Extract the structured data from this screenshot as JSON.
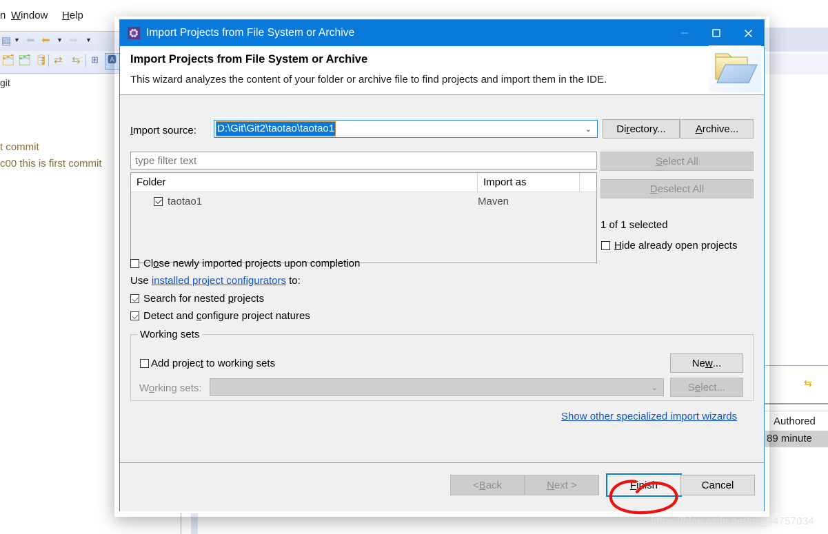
{
  "background": {
    "menu": [
      {
        "label": "n",
        "accel": ""
      },
      {
        "label": "Window",
        "accel": "W"
      },
      {
        "label": "Help",
        "accel": "H"
      }
    ],
    "label_git": "git",
    "commit_line1": "t commit",
    "commit_line2": "c00 this is first commit",
    "right_panel": {
      "authored_header": "Authored",
      "authored_value": "89 minute"
    }
  },
  "dialog": {
    "title": "Import Projects from File System or Archive",
    "window_buttons": {
      "minimize": "minimize-button",
      "maximize": "maximize-button",
      "close": "close-button"
    },
    "header": {
      "heading": "Import Projects from File System or Archive",
      "description": "This wizard analyzes the content of your folder or archive file to find projects and import them in the IDE."
    },
    "import_source": {
      "label": "Import source:",
      "label_mnemonic": "I",
      "value": "D:\\Git\\Git2\\taotao\\taotao1",
      "selected": true,
      "directory_button": "Directory...",
      "directory_mnemonic": "r",
      "archive_button": "Archive...",
      "archive_mnemonic": "A"
    },
    "filter": {
      "placeholder": "type filter text",
      "value": ""
    },
    "table": {
      "columns": [
        "Folder",
        "Import as"
      ],
      "rows": [
        {
          "folder": "taotao1",
          "import_as": "Maven",
          "checked": true
        }
      ]
    },
    "side_buttons": {
      "select_all": "Select All",
      "select_all_mnemonic": "S",
      "select_all_enabled": false,
      "deselect_all": "Deselect All",
      "deselect_all_mnemonic": "D",
      "deselect_all_enabled": false,
      "selection_status": "1 of 1 selected",
      "hide_open_projects": "Hide already open projects",
      "hide_open_projects_mnemonic": "H",
      "hide_open_projects_checked": false
    },
    "options": {
      "close_newly_imported": "Close newly imported projects upon completion",
      "close_newly_imported_checked": false,
      "use_prefix": "Use ",
      "configurators_link": "installed project configurators",
      "use_suffix": " to:",
      "search_nested": "Search for nested projects",
      "search_nested_checked": true,
      "detect_natures": "Detect and configure project natures",
      "detect_natures_checked": true
    },
    "working_sets": {
      "group_title": "Working sets",
      "add_to_working_sets": "Add project to working sets",
      "add_to_working_sets_checked": false,
      "working_sets_label": "Working sets:",
      "working_sets_value": "",
      "new_button": "New...",
      "new_mnemonic": "w",
      "select_button": "Select...",
      "select_mnemonic": "e",
      "select_enabled": false
    },
    "other_wizards_link": "Show other specialized import wizards",
    "footer": {
      "back": "< Back",
      "back_mnemonic": "B",
      "back_enabled": false,
      "next": "Next >",
      "next_mnemonic": "N",
      "next_enabled": false,
      "finish": "Finish",
      "finish_mnemonic": "F",
      "finish_focused": true,
      "cancel": "Cancel"
    }
  },
  "annotation": {
    "shape": "red-hand-drawn-circle",
    "target": "Finish",
    "color": "#e8140f"
  },
  "watermark": "https://blog.csdn.net/qq_44757034"
}
